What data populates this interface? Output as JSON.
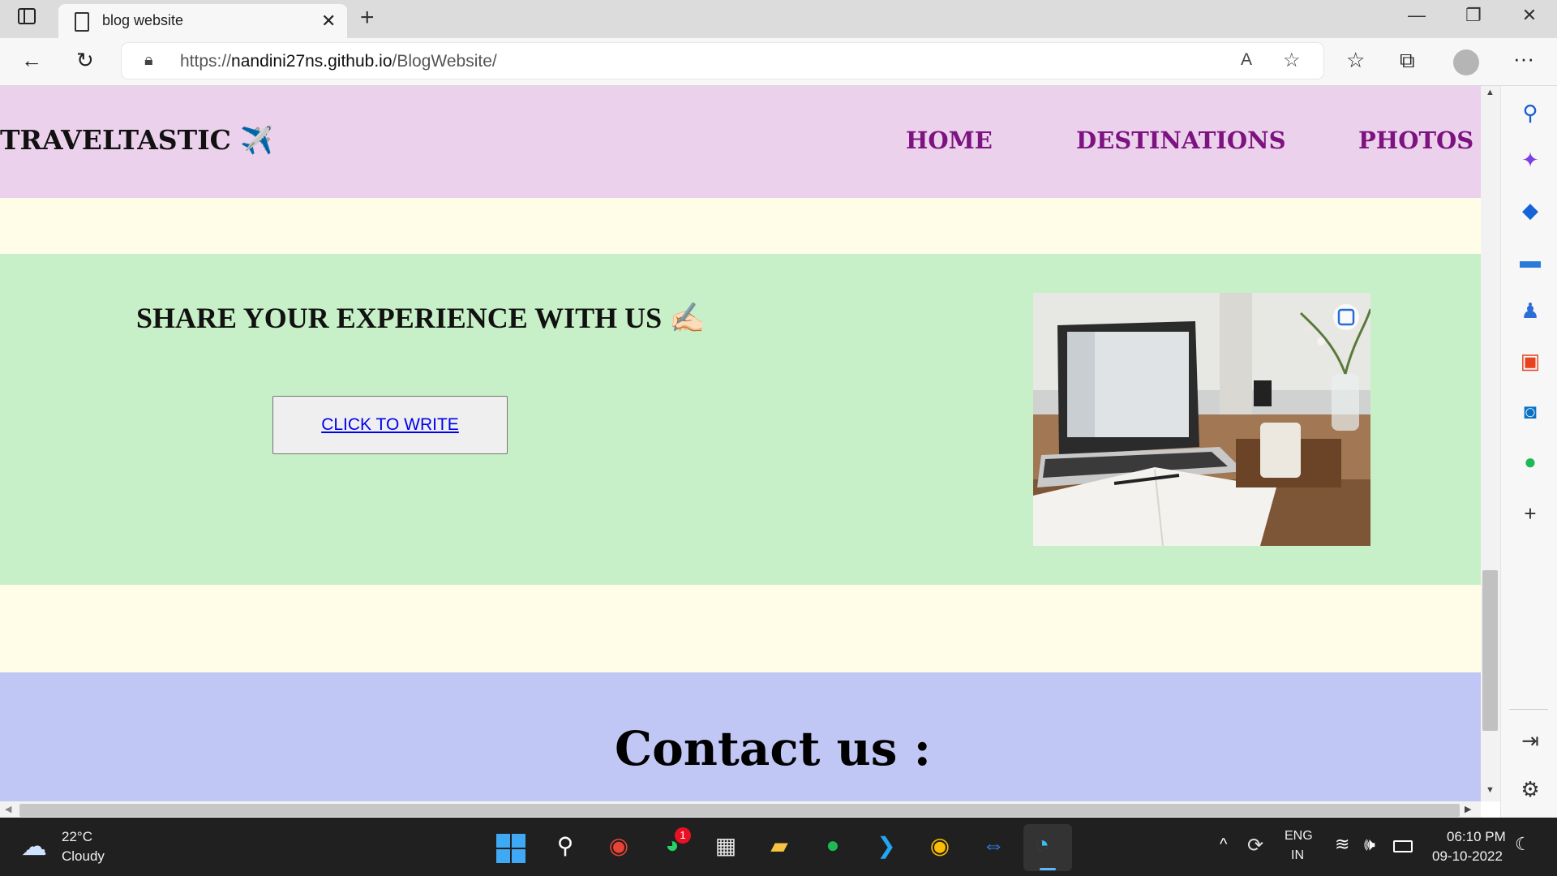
{
  "browser": {
    "tab_title": "blog website",
    "url_prefix": "https://",
    "url_host": "nandini27ns.github.io",
    "url_path": "/BlogWebsite/"
  },
  "site": {
    "brand": "TRAVELTASTIC ✈️",
    "nav": [
      "HOME",
      "DESTINATIONS",
      "PHOTOS"
    ],
    "share_title": "SHARE YOUR EXPERIENCE WITH US ✍🏻",
    "write_button": "CLICK TO WRITE",
    "contact_title": "Contact us :"
  },
  "taskbar": {
    "temperature": "22°C",
    "weather": "Cloudy",
    "whatsapp_badge": "1",
    "lang_top": "ENG",
    "lang_bottom": "IN",
    "time": "06:10 PM",
    "date": "09-10-2022"
  },
  "colors": {
    "nav_bg": "#ecd1ec",
    "nav_link": "#7c1380",
    "share_bg": "#c8f0c8",
    "contact_bg": "#c0c7f4",
    "page_bg": "#fffde8"
  }
}
